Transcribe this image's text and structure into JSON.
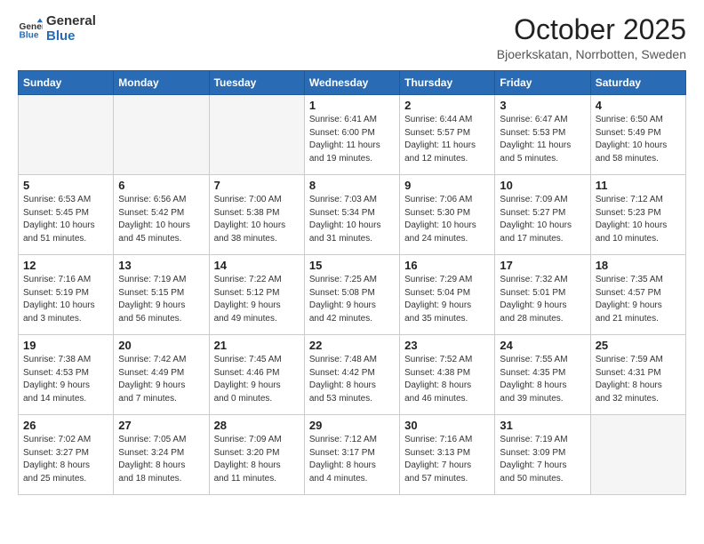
{
  "header": {
    "logo_line1": "General",
    "logo_line2": "Blue",
    "month": "October 2025",
    "location": "Bjoerkskatan, Norrbotten, Sweden"
  },
  "weekdays": [
    "Sunday",
    "Monday",
    "Tuesday",
    "Wednesday",
    "Thursday",
    "Friday",
    "Saturday"
  ],
  "weeks": [
    [
      {
        "day": "",
        "info": ""
      },
      {
        "day": "",
        "info": ""
      },
      {
        "day": "",
        "info": ""
      },
      {
        "day": "1",
        "info": "Sunrise: 6:41 AM\nSunset: 6:00 PM\nDaylight: 11 hours\nand 19 minutes."
      },
      {
        "day": "2",
        "info": "Sunrise: 6:44 AM\nSunset: 5:57 PM\nDaylight: 11 hours\nand 12 minutes."
      },
      {
        "day": "3",
        "info": "Sunrise: 6:47 AM\nSunset: 5:53 PM\nDaylight: 11 hours\nand 5 minutes."
      },
      {
        "day": "4",
        "info": "Sunrise: 6:50 AM\nSunset: 5:49 PM\nDaylight: 10 hours\nand 58 minutes."
      }
    ],
    [
      {
        "day": "5",
        "info": "Sunrise: 6:53 AM\nSunset: 5:45 PM\nDaylight: 10 hours\nand 51 minutes."
      },
      {
        "day": "6",
        "info": "Sunrise: 6:56 AM\nSunset: 5:42 PM\nDaylight: 10 hours\nand 45 minutes."
      },
      {
        "day": "7",
        "info": "Sunrise: 7:00 AM\nSunset: 5:38 PM\nDaylight: 10 hours\nand 38 minutes."
      },
      {
        "day": "8",
        "info": "Sunrise: 7:03 AM\nSunset: 5:34 PM\nDaylight: 10 hours\nand 31 minutes."
      },
      {
        "day": "9",
        "info": "Sunrise: 7:06 AM\nSunset: 5:30 PM\nDaylight: 10 hours\nand 24 minutes."
      },
      {
        "day": "10",
        "info": "Sunrise: 7:09 AM\nSunset: 5:27 PM\nDaylight: 10 hours\nand 17 minutes."
      },
      {
        "day": "11",
        "info": "Sunrise: 7:12 AM\nSunset: 5:23 PM\nDaylight: 10 hours\nand 10 minutes."
      }
    ],
    [
      {
        "day": "12",
        "info": "Sunrise: 7:16 AM\nSunset: 5:19 PM\nDaylight: 10 hours\nand 3 minutes."
      },
      {
        "day": "13",
        "info": "Sunrise: 7:19 AM\nSunset: 5:15 PM\nDaylight: 9 hours\nand 56 minutes."
      },
      {
        "day": "14",
        "info": "Sunrise: 7:22 AM\nSunset: 5:12 PM\nDaylight: 9 hours\nand 49 minutes."
      },
      {
        "day": "15",
        "info": "Sunrise: 7:25 AM\nSunset: 5:08 PM\nDaylight: 9 hours\nand 42 minutes."
      },
      {
        "day": "16",
        "info": "Sunrise: 7:29 AM\nSunset: 5:04 PM\nDaylight: 9 hours\nand 35 minutes."
      },
      {
        "day": "17",
        "info": "Sunrise: 7:32 AM\nSunset: 5:01 PM\nDaylight: 9 hours\nand 28 minutes."
      },
      {
        "day": "18",
        "info": "Sunrise: 7:35 AM\nSunset: 4:57 PM\nDaylight: 9 hours\nand 21 minutes."
      }
    ],
    [
      {
        "day": "19",
        "info": "Sunrise: 7:38 AM\nSunset: 4:53 PM\nDaylight: 9 hours\nand 14 minutes."
      },
      {
        "day": "20",
        "info": "Sunrise: 7:42 AM\nSunset: 4:49 PM\nDaylight: 9 hours\nand 7 minutes."
      },
      {
        "day": "21",
        "info": "Sunrise: 7:45 AM\nSunset: 4:46 PM\nDaylight: 9 hours\nand 0 minutes."
      },
      {
        "day": "22",
        "info": "Sunrise: 7:48 AM\nSunset: 4:42 PM\nDaylight: 8 hours\nand 53 minutes."
      },
      {
        "day": "23",
        "info": "Sunrise: 7:52 AM\nSunset: 4:38 PM\nDaylight: 8 hours\nand 46 minutes."
      },
      {
        "day": "24",
        "info": "Sunrise: 7:55 AM\nSunset: 4:35 PM\nDaylight: 8 hours\nand 39 minutes."
      },
      {
        "day": "25",
        "info": "Sunrise: 7:59 AM\nSunset: 4:31 PM\nDaylight: 8 hours\nand 32 minutes."
      }
    ],
    [
      {
        "day": "26",
        "info": "Sunrise: 7:02 AM\nSunset: 3:27 PM\nDaylight: 8 hours\nand 25 minutes."
      },
      {
        "day": "27",
        "info": "Sunrise: 7:05 AM\nSunset: 3:24 PM\nDaylight: 8 hours\nand 18 minutes."
      },
      {
        "day": "28",
        "info": "Sunrise: 7:09 AM\nSunset: 3:20 PM\nDaylight: 8 hours\nand 11 minutes."
      },
      {
        "day": "29",
        "info": "Sunrise: 7:12 AM\nSunset: 3:17 PM\nDaylight: 8 hours\nand 4 minutes."
      },
      {
        "day": "30",
        "info": "Sunrise: 7:16 AM\nSunset: 3:13 PM\nDaylight: 7 hours\nand 57 minutes."
      },
      {
        "day": "31",
        "info": "Sunrise: 7:19 AM\nSunset: 3:09 PM\nDaylight: 7 hours\nand 50 minutes."
      },
      {
        "day": "",
        "info": ""
      }
    ]
  ]
}
